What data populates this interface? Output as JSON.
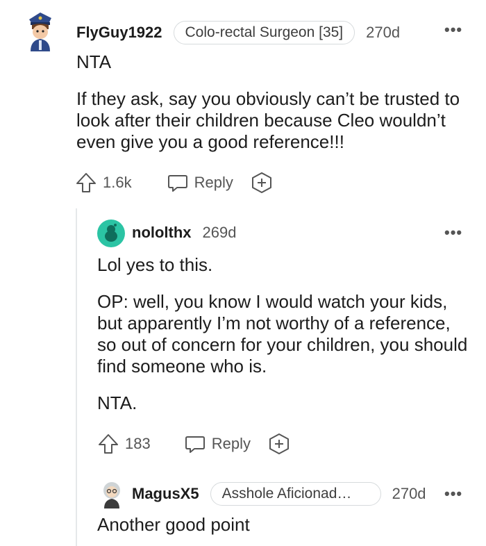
{
  "comments": [
    {
      "username": "FlyGuy1922",
      "flair": "Colo-rectal Surgeon [35]",
      "age": "270d",
      "more": "•••",
      "paragraphs": [
        "NTA",
        "If they ask, say you obviously can’t be trusted to look after their children because Cleo wouldn’t even give you a good reference!!!"
      ],
      "votes": "1.6k",
      "reply_label": "Reply"
    },
    {
      "username": "nololthx",
      "age": "269d",
      "more": "•••",
      "paragraphs": [
        "Lol yes to this.",
        "OP: well, you know I would watch your kids, but apparently I’m not worthy of a reference, so out of concern for your children, you should find someone who is.",
        "NTA."
      ],
      "votes": "183",
      "reply_label": "Reply"
    },
    {
      "username": "MagusX5",
      "flair": "Asshole Aficionad…",
      "age": "270d",
      "more": "•••",
      "paragraphs": [
        "Another good point"
      ]
    }
  ],
  "colors": {
    "text": "#1c1c1c",
    "meta": "#555555",
    "flair_border": "#d6dadc",
    "thread_line": "#e5e8ea",
    "avatar_teal": "#2bc4a4"
  },
  "icons": [
    "upvote-icon",
    "comment-bubble-icon",
    "award-icon",
    "overflow-menu-icon"
  ]
}
